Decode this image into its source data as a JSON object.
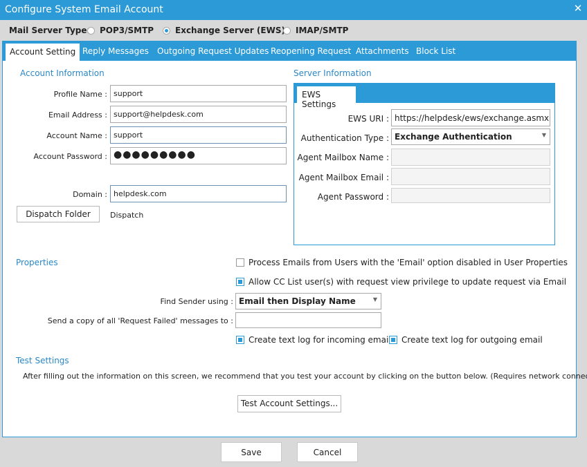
{
  "window": {
    "title": "Configure System Email Account",
    "close_glyph": "✕"
  },
  "mail_server": {
    "label": "Mail Server Type:",
    "options": [
      "POP3/SMTP",
      "Exchange Server (EWS)",
      "IMAP/SMTP"
    ],
    "selected": "Exchange Server (EWS)"
  },
  "tabs": [
    "Account Setting",
    "Reply Messages",
    "Outgoing Request Updates",
    "Reopening Request",
    "Attachments",
    "Block List"
  ],
  "account": {
    "section_title": "Account Information",
    "profile_name_label": "Profile Name :",
    "profile_name": "support",
    "email_label": "Email Address :",
    "email": "support@helpdesk.com",
    "account_name_label": "Account Name :",
    "account_name": "support",
    "password_label": "Account Password :",
    "password_mask": "●●●●●●●●●",
    "domain_label": "Domain :",
    "domain": "helpdesk.com",
    "dispatch_button": "Dispatch Folder",
    "dispatch_value": "Dispatch"
  },
  "server": {
    "section_title": "Server Information",
    "tab": "EWS Settings",
    "uri_label": "EWS URI :",
    "uri": "https://helpdesk/ews/exchange.asmx",
    "auth_label": "Authentication Type :",
    "auth_value": "Exchange Authentication",
    "mailbox_name_label": "Agent Mailbox Name :",
    "mailbox_email_label": "Agent Mailbox Email :",
    "agent_password_label": "Agent Password :"
  },
  "properties": {
    "section_title": "Properties",
    "process_emails": "Process Emails from Users with the 'Email' option disabled in User Properties",
    "allow_cc": "Allow CC List user(s) with request view privilege to update request via Email",
    "find_sender_label": "Find Sender using :",
    "find_sender_value": "Email then Display Name",
    "copy_failed_label": "Send a copy of all 'Request Failed' messages to :",
    "copy_failed_value": "",
    "log_incoming": "Create text log for incoming email",
    "log_outgoing": "Create text log for outgoing email"
  },
  "test": {
    "section_title": "Test Settings",
    "description": "After filling out the information on this screen, we recommend that you test your account by clicking on the button below. (Requires network connection)",
    "button": "Test Account Settings..."
  },
  "footer": {
    "save": "Save",
    "cancel": "Cancel"
  },
  "icons": {
    "dropdown": "▼"
  },
  "colors": {
    "accent": "#2b9ad6",
    "section_title": "#2b87c6"
  }
}
